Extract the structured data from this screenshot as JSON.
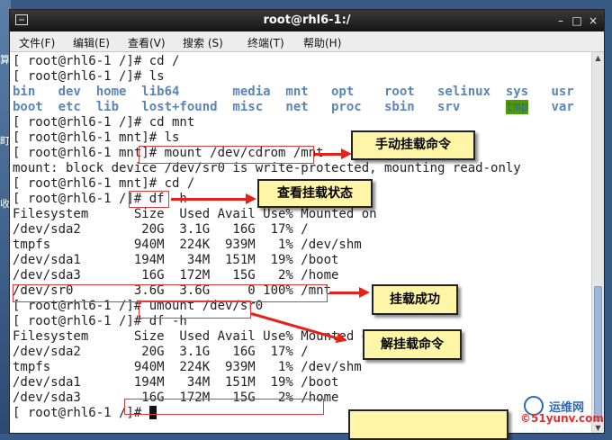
{
  "desktop": {
    "left_chars": [
      "算",
      "町",
      "收"
    ]
  },
  "window": {
    "title": "root@rhl6-1:/",
    "icon_glyph": "▭",
    "buttons": {
      "minimize": "–",
      "maximize": "□",
      "close": "×"
    }
  },
  "menu": [
    {
      "label": "文件(F)"
    },
    {
      "label": "编辑(E)"
    },
    {
      "label": "查看(V)"
    },
    {
      "label": "搜索 (S)"
    },
    {
      "label": "终端(T)"
    },
    {
      "label": "帮助(H)"
    }
  ],
  "terminal": {
    "lines": [
      [
        {
          "t": "[ root@rhl6-1 /]# cd /"
        }
      ],
      [
        {
          "t": "[ root@rhl6-1 /]# ls"
        }
      ],
      [
        {
          "t": "bin   dev  home  lib64       media  mnt   opt    root   selinux  sys   usr",
          "c": "c"
        }
      ],
      [
        {
          "t": "boot  etc  lib   lost+found  misc   net   proc   sbin   srv      ",
          "c": "c"
        },
        {
          "t": "tmp",
          "c": "hl"
        },
        {
          "t": "   var",
          "c": "c"
        }
      ],
      [
        {
          "t": "[ root@rhl6-1 /]# cd mnt"
        }
      ],
      [
        {
          "t": "[ root@rhl6-1 mnt]# ls"
        }
      ],
      [
        {
          "t": "[ root@rhl6-1 mnt]# mount /dev/cdrom /mnt"
        }
      ],
      [
        {
          "t": "mount: block device /dev/sr0 is write-protected, mounting read-only"
        }
      ],
      [
        {
          "t": "[ root@rhl6-1 mnt]# cd /"
        }
      ],
      [
        {
          "t": "[ root@rhl6-1 /]# df -h"
        }
      ],
      [
        {
          "t": "Filesystem      Size  Used Avail Use% Mounted on"
        }
      ],
      [
        {
          "t": "/dev/sda2        20G  3.1G   16G  17% /"
        }
      ],
      [
        {
          "t": "tmpfs           940M  224K  939M   1% /dev/shm"
        }
      ],
      [
        {
          "t": "/dev/sda1       194M   34M  151M  19% /boot"
        }
      ],
      [
        {
          "t": "/dev/sda3        16G  172M   15G   2% /home"
        }
      ],
      [
        {
          "t": "/dev/sr0        3.6G  3.6G     0 100% /mnt"
        }
      ],
      [
        {
          "t": "[ root@rhl6-1 /]# umount /dev/sr0"
        }
      ],
      [
        {
          "t": "[ root@rhl6-1 /]# df -h"
        }
      ],
      [
        {
          "t": "Filesystem      Size  Used Avail Use% Mounted on"
        }
      ],
      [
        {
          "t": "/dev/sda2        20G  3.1G   16G  17% /"
        }
      ],
      [
        {
          "t": "tmpfs           940M  224K  939M   1% /dev/shm"
        }
      ],
      [
        {
          "t": "/dev/sda1       194M   34M  151M  19% /boot"
        }
      ],
      [
        {
          "t": "/dev/sda3        16G  172M   15G   2% /home"
        }
      ],
      [
        {
          "t": "[ root@rhl6-1 /]# "
        }
      ]
    ]
  },
  "annotations": {
    "manual_mount": "手动挂载命令",
    "check_status": "查看挂载状态",
    "mount_success": "挂载成功",
    "unmount_cmd": "解挂载命令"
  },
  "watermark": {
    "line1": "运维网",
    "line2": "©51yunv.com"
  },
  "colors": {
    "arrow": "#e8201a",
    "note_bg": "#fff5a6",
    "dir_blue": "#5b86b8",
    "tmp_bg": "#4e9a06"
  }
}
